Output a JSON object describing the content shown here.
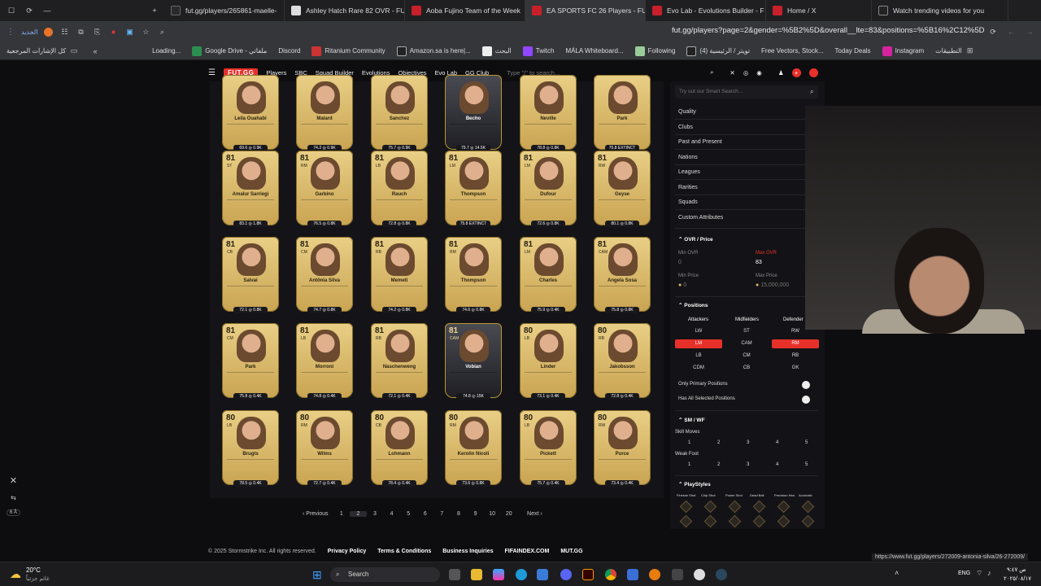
{
  "browser": {
    "tabs": [
      {
        "title": "fut.gg/players/265861-maelle-",
        "active": false,
        "color": "#2a2a2e"
      },
      {
        "title": "Ashley Hatch Rare 82 OVR - FU",
        "active": false,
        "color": "#ddd"
      },
      {
        "title": "Aoba Fujino Team of the Week",
        "active": false,
        "color": "#c8202a"
      },
      {
        "title": "EA SPORTS FC 26 Players - FUT",
        "active": true,
        "color": "#c8202a"
      },
      {
        "title": "Evo Lab - Evolutions Builder - F",
        "active": false,
        "color": "#c8202a"
      },
      {
        "title": "Home / X",
        "active": false,
        "color": "#c8202a"
      },
      {
        "title": "Watch trending videos for you",
        "active": false,
        "color": "#222"
      }
    ],
    "address_bar": {
      "url": "fut.gg/players?page=2&gender=%5B2%5D&overall__lte=83&positions=%5B16%2C12%5D",
      "search_label": "الجديد"
    },
    "bookmarks": [
      "كل الإشارات المرجعية",
      "Loading...",
      "Google Drive - ملفاتي",
      "Discord",
      "Ritanium Community",
      "Amazon.sa is here|...",
      "البحث",
      "Twitch",
      "MÁLA Whiteboard...",
      "Following",
      "(4) تويتر / الرئيسية",
      "Free Vectors, Stock...",
      "Today Deals",
      "Instagram",
      "التطبيقات"
    ]
  },
  "site": {
    "logo": "FUT.GG",
    "nav": [
      "Players",
      "SBC",
      "Squad Builder",
      "Evolutions",
      "Objectives",
      "Evo Lab",
      "GG Club"
    ],
    "search_placeholder": "Type \"/\" to search..."
  },
  "cards": [
    {
      "ovr": "",
      "pos": "",
      "name": "Leila Ouahabi",
      "price": "69.6 ◎ 0.9K",
      "black": false
    },
    {
      "ovr": "",
      "pos": "",
      "name": "Malard",
      "price": "74.2 ◎ 0.9K",
      "black": false
    },
    {
      "ovr": "",
      "pos": "",
      "name": "Sanchez",
      "price": "75.7 ◎ 0.9K",
      "black": false
    },
    {
      "ovr": "",
      "pos": "",
      "name": "Becho",
      "price": "79.7 ◎ 14.5K",
      "black": true
    },
    {
      "ovr": "",
      "pos": "",
      "name": "Neville",
      "price": "78.8 ◎ 0.8K",
      "black": false
    },
    {
      "ovr": "",
      "pos": "",
      "name": "Park",
      "price": "75.8 EXTINCT",
      "black": false
    },
    {
      "ovr": "81",
      "pos": "ST",
      "name": "Amalur Sarriegi",
      "price": "83.1 ◎ 1.8K",
      "black": false
    },
    {
      "ovr": "81",
      "pos": "RM",
      "name": "Garbino",
      "price": "76.5 ◎ 0.8K",
      "black": false
    },
    {
      "ovr": "81",
      "pos": "LB",
      "name": "Rauch",
      "price": "72.8 ◎ 0.8K",
      "black": false
    },
    {
      "ovr": "81",
      "pos": "LM",
      "name": "Thompson",
      "price": "75.8 EXTINCT",
      "black": false
    },
    {
      "ovr": "81",
      "pos": "LM",
      "name": "Dufour",
      "price": "72.6 ◎ 0.8K",
      "black": false
    },
    {
      "ovr": "81",
      "pos": "RW",
      "name": "Geyse",
      "price": "80.1 ◎ 0.8K",
      "black": false
    },
    {
      "ovr": "81",
      "pos": "CB",
      "name": "Salvai",
      "price": "72.1 ◎ 0.8K",
      "black": false
    },
    {
      "ovr": "81",
      "pos": "CM",
      "name": "Antônia Silva",
      "price": "74.7 ◎ 0.8K",
      "black": false
    },
    {
      "ovr": "81",
      "pos": "RB",
      "name": "Memeti",
      "price": "74.2 ◎ 0.8K",
      "black": false
    },
    {
      "ovr": "81",
      "pos": "RM",
      "name": "Thompson",
      "price": "74.6 ◎ 0.8K",
      "black": false
    },
    {
      "ovr": "81",
      "pos": "LM",
      "name": "Charles",
      "price": "75.9 ◎ 0.4K",
      "black": false
    },
    {
      "ovr": "81",
      "pos": "CAM",
      "name": "Angela Sosa",
      "price": "75.8 ◎ 0.8K",
      "black": false
    },
    {
      "ovr": "81",
      "pos": "CM",
      "name": "Park",
      "price": "75.8 ◎ 0.4K",
      "black": false
    },
    {
      "ovr": "81",
      "pos": "LB",
      "name": "Morroni",
      "price": "74.8 ◎ 0.4K",
      "black": false
    },
    {
      "ovr": "81",
      "pos": "RB",
      "name": "Naschenweng",
      "price": "72.1 ◎ 0.4K",
      "black": false
    },
    {
      "ovr": "81",
      "pos": "CAM",
      "name": "Vobian",
      "price": "74.8 ◎ 15K",
      "black": true
    },
    {
      "ovr": "80",
      "pos": "LB",
      "name": "Linder",
      "price": "73.1 ◎ 0.4K",
      "black": false
    },
    {
      "ovr": "80",
      "pos": "RB",
      "name": "Jakobsson",
      "price": "72.8 ◎ 0.4K",
      "black": false
    },
    {
      "ovr": "80",
      "pos": "LB",
      "name": "Brugts",
      "price": "78.5 ◎ 0.4K",
      "black": false
    },
    {
      "ovr": "80",
      "pos": "RM",
      "name": "Wilms",
      "price": "72.7 ◎ 0.4K",
      "black": false
    },
    {
      "ovr": "80",
      "pos": "CB",
      "name": "Lohmann",
      "price": "78.4 ◎ 0.4K",
      "black": false
    },
    {
      "ovr": "80",
      "pos": "RM",
      "name": "Kerolin Nicoli",
      "price": "73.6 ◎ 0.8K",
      "black": false
    },
    {
      "ovr": "80",
      "pos": "LB",
      "name": "Pickett",
      "price": "75.7 ◎ 0.4K",
      "black": false
    },
    {
      "ovr": "80",
      "pos": "RW",
      "name": "Purce",
      "price": "73.4 ◎ 0.4K",
      "black": false
    }
  ],
  "pagination": {
    "previous": "Previous",
    "pages": [
      "1",
      "2",
      "3",
      "4",
      "5",
      "6",
      "7",
      "8",
      "9",
      "10",
      "20"
    ],
    "current": "2",
    "next": "Next"
  },
  "footer": {
    "copyright": "© 2025 Stormstrike Inc. All rights reserved.",
    "links": [
      "Privacy Policy",
      "Terms & Conditions",
      "Business Inquiries",
      "FIFAINDEX.COM",
      "MUT.GG"
    ]
  },
  "sidebar": {
    "search_placeholder": "Try out our Smart Search...",
    "filters": [
      "Quality",
      "Clubs",
      "Past and Present",
      "Nations",
      "Leagues",
      "Rarities",
      "Squads",
      "Custom Attributes"
    ],
    "ovr_price": {
      "title": "OVR / Price",
      "min_ovr_label": "Min OVR",
      "min_ovr_value": "0",
      "max_ovr_label": "Max OVR",
      "max_ovr_value": "83",
      "min_price_label": "Min Price",
      "min_price_value": "0",
      "max_price_label": "Max Price",
      "max_price_value": "15,000,000"
    },
    "positions": {
      "title": "Positions",
      "groups": [
        "Attackers",
        "Midfielders",
        "Defender"
      ],
      "buttons": [
        {
          "label": "LW",
          "on": false
        },
        {
          "label": "ST",
          "on": false
        },
        {
          "label": "RW",
          "on": false
        },
        {
          "label": "LM",
          "on": true
        },
        {
          "label": "CAM",
          "on": false
        },
        {
          "label": "RM",
          "on": true
        },
        {
          "label": "LB",
          "on": false
        },
        {
          "label": "CM",
          "on": false
        },
        {
          "label": "RB",
          "on": false
        },
        {
          "label": "CDM",
          "on": false
        },
        {
          "label": "CB",
          "on": false
        },
        {
          "label": "GK",
          "on": false
        }
      ],
      "only_primary": "Only Primary Positions",
      "has_all": "Has All Selected Positions"
    },
    "smwf": {
      "title": "SM / WF",
      "skill_moves": "Skill Moves",
      "weak_foot": "Weak Foot",
      "values": [
        "1",
        "2",
        "3",
        "4",
        "5"
      ]
    },
    "playstyles": {
      "title": "PlayStyles",
      "labels": [
        "Finesse Shot",
        "Chip Shot",
        "Power Shot",
        "Dead Ball",
        "Precision Hea",
        "Acrobatic"
      ]
    }
  },
  "status_bar_url": "https://www.fut.gg/players/272009-antonia-silva/26-272009/",
  "weather": {
    "temp": "20°C",
    "desc": "غائم جزئياً"
  },
  "taskbar": {
    "search": "Search",
    "lang": "ENG",
    "time": "ص ٩:٤٧",
    "date": "٢٠٢٥/٠٨/١٧"
  },
  "left_widget": {
    "badge": "6 Å"
  },
  "colors": {
    "accent": "#e8302a",
    "card_gold": "#d9b96a",
    "bg": "#0d0d10"
  }
}
